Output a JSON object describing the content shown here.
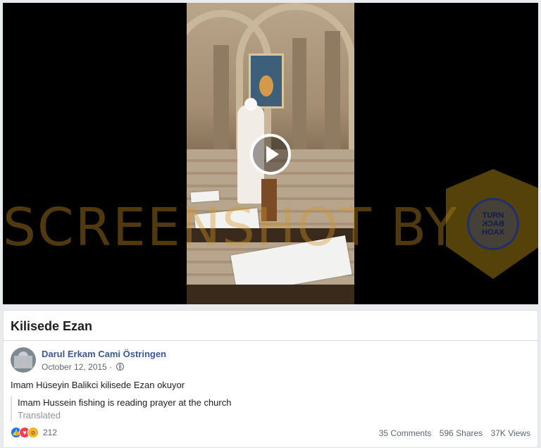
{
  "watermark": {
    "text": "SCREENSHOT BY"
  },
  "seal": {
    "line1": "TURN",
    "line2": "BACK",
    "line3": "HOAX",
    "org": "MASYARAKAT ANTI FITNAH INDONESIA",
    "brand": "MAFINDO"
  },
  "post": {
    "title": "Kilisede Ezan",
    "author": "Darul Erkam Cami Östringen",
    "date": "October 12, 2015 ·",
    "text": "Imam Hüseyin Balikci kilisede Ezan okuyor",
    "translation": "Imam Hussein fishing is reading prayer at the church",
    "translated_label": "Translated",
    "reaction_icons": [
      "like-icon",
      "love-icon",
      "wow-icon"
    ],
    "reaction_count": "212",
    "comments": "35 Comments",
    "shares": "596 Shares",
    "views": "37K Views"
  },
  "colors": {
    "link": "#385898",
    "accent": "#1877f2",
    "watermark": "#d29628"
  }
}
